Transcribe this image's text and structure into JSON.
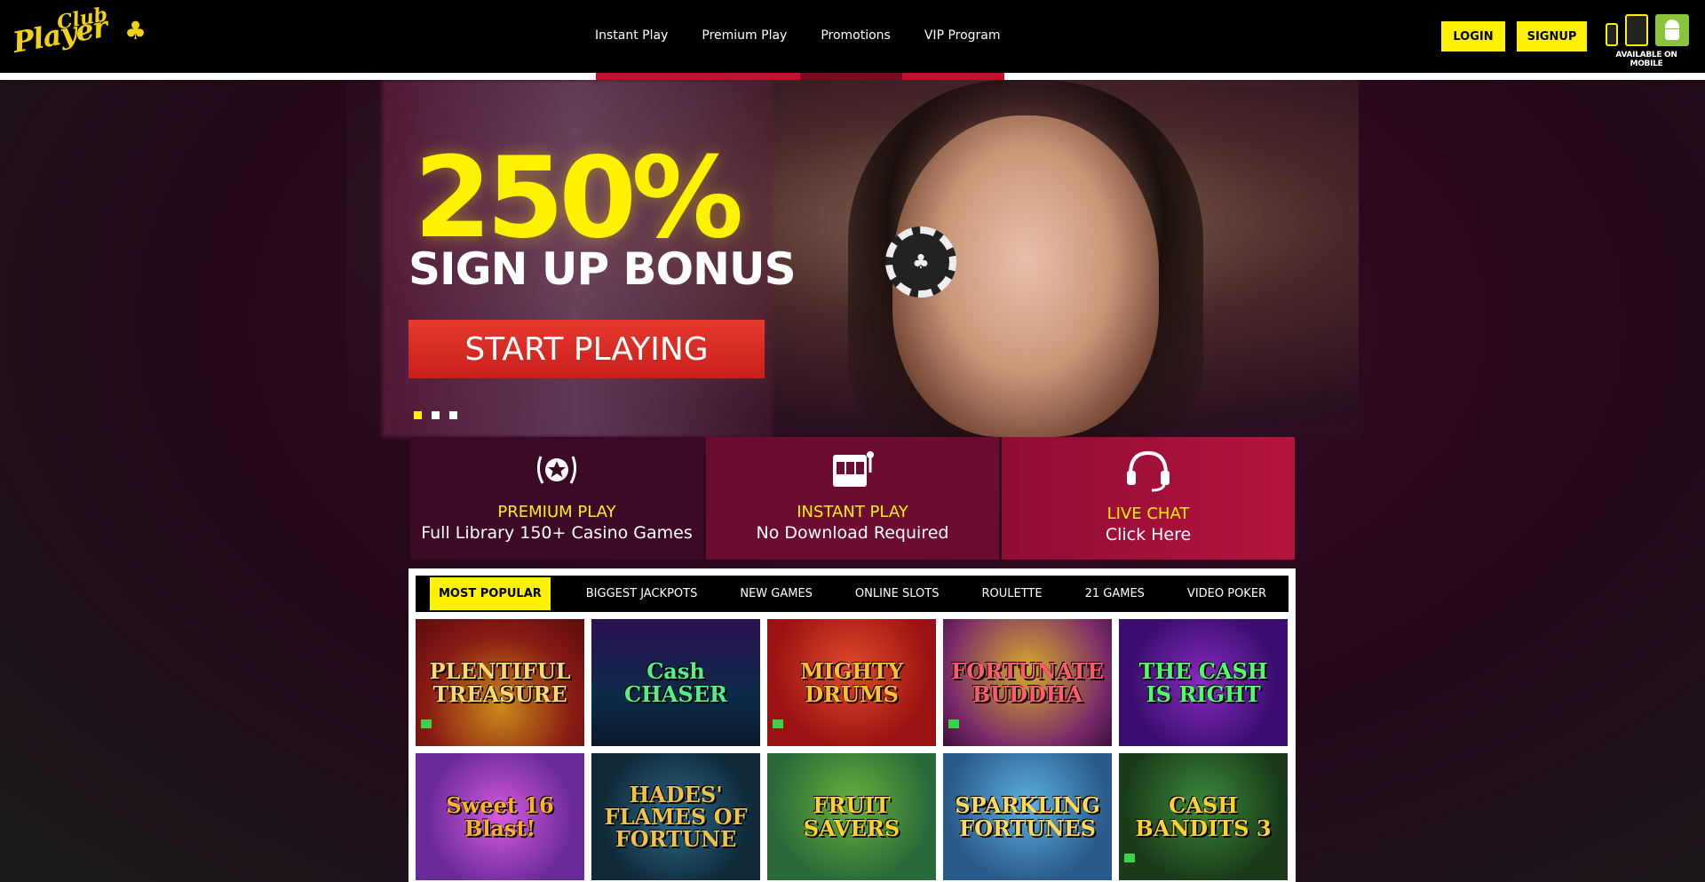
{
  "header": {
    "logo_club": "Club",
    "logo_player": "Player",
    "logo_icon": "clover-icon",
    "nav": [
      "Instant Play",
      "Premium Play",
      "Promotions",
      "VIP Program"
    ],
    "login_label": "LOGIN",
    "signup_label": "SIGNUP",
    "mobile_icons": [
      "phone-icon",
      "tablet-icon",
      "android-icon"
    ],
    "mobile_label": "AVAILABLE ON MOBILE"
  },
  "hero": {
    "headline": "250%",
    "subheadline": "SIGN UP BONUS",
    "cta_label": "START PLAYING",
    "slides_count": 3,
    "active_slide": 1
  },
  "features": [
    {
      "icon": "star-laurel-icon",
      "title": "PREMIUM PLAY",
      "subtitle": "Full Library 150+ Casino Games"
    },
    {
      "icon": "slot-machine-icon",
      "title": "INSTANT PLAY",
      "subtitle": "No Download Required"
    },
    {
      "icon": "headset-icon",
      "title": "LIVE CHAT",
      "subtitle": "Click Here"
    }
  ],
  "games": {
    "tabs": [
      "MOST POPULAR",
      "BIGGEST JACKPOTS",
      "NEW GAMES",
      "ONLINE SLOTS",
      "ROULETTE",
      "21 GAMES",
      "VIDEO POKER"
    ],
    "active_tab": "MOST POPULAR",
    "tiles": [
      "PLENTIFUL TREASURE",
      "Cash CHASER",
      "MIGHTY DRUMS",
      "FORTUNATE BUDDHA",
      "THE CASH IS RIGHT",
      "Sweet 16 Blast!",
      "HADES' FLAMES OF FORTUNE",
      "FRUIT SAVERS",
      "SPARKLING FORTUNES",
      "CASH BANDITS 3"
    ]
  },
  "colors": {
    "accent_yellow": "#fff200",
    "brand_red": "#c8102e",
    "header_bg": "#000000"
  }
}
